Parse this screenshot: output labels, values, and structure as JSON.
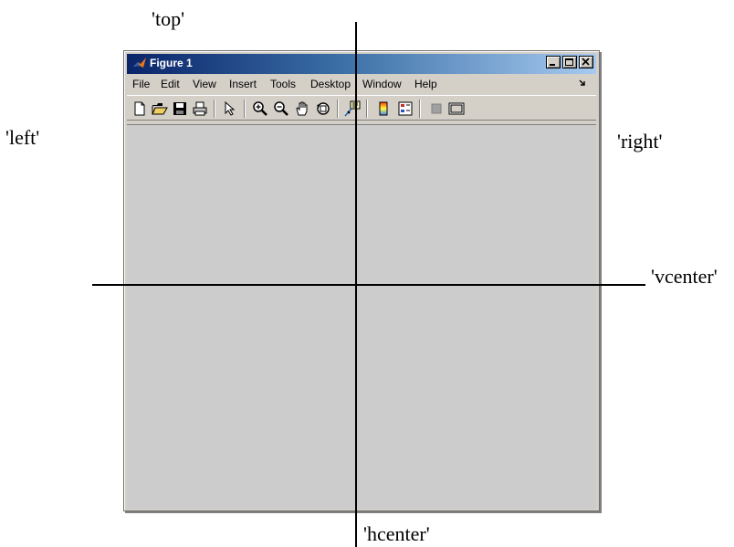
{
  "annotations": {
    "top": "'top'",
    "left": "'left'",
    "right": "'right'",
    "vcenter": "'vcenter'",
    "hcenter": "'hcenter'"
  },
  "window": {
    "title": "Figure 1",
    "controls": [
      "minimize-icon",
      "maximize-icon",
      "close-icon"
    ],
    "menu": [
      "File",
      "Edit",
      "View",
      "Insert",
      "Tools",
      "Desktop",
      "Window",
      "Help"
    ],
    "toolbar_icons": [
      "new-figure-icon",
      "open-file-icon",
      "save-icon",
      "print-icon",
      "pointer-icon",
      "zoom-in-icon",
      "zoom-out-icon",
      "pan-hand-icon",
      "rotate-3d-icon",
      "data-cursor-icon",
      "colorbar-icon",
      "legend-icon",
      "hide-plot-tools-icon",
      "show-plot-tools-icon"
    ]
  },
  "colors": {
    "title_gradient_start": "#0a246a",
    "title_gradient_end": "#a6caf0",
    "window_face": "#d4d0c8",
    "figure_background": "#cccccc"
  }
}
